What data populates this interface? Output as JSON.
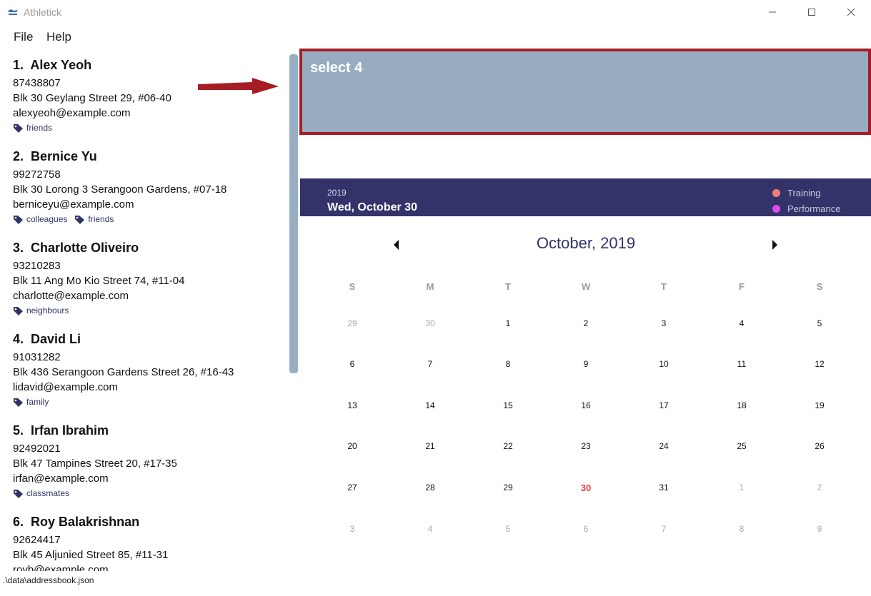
{
  "window": {
    "title": "Athletick",
    "controls": {
      "minimize_icon": "minimize-icon",
      "maximize_icon": "maximize-icon",
      "close_icon": "close-icon"
    }
  },
  "menu": {
    "file": "File",
    "help": "Help"
  },
  "persons": [
    {
      "index": "1.",
      "name": "Alex Yeoh",
      "phone": "87438807",
      "address": "Blk 30 Geylang Street 29, #06-40",
      "email": "alexyeoh@example.com",
      "tags": [
        "friends"
      ]
    },
    {
      "index": "2.",
      "name": "Bernice Yu",
      "phone": "99272758",
      "address": "Blk 30 Lorong 3 Serangoon Gardens, #07-18",
      "email": "berniceyu@example.com",
      "tags": [
        "colleagues",
        "friends"
      ]
    },
    {
      "index": "3.",
      "name": "Charlotte Oliveiro",
      "phone": "93210283",
      "address": "Blk 11 Ang Mo Kio Street 74, #11-04",
      "email": "charlotte@example.com",
      "tags": [
        "neighbours"
      ]
    },
    {
      "index": "4.",
      "name": "David Li",
      "phone": "91031282",
      "address": "Blk 436 Serangoon Gardens Street 26, #16-43",
      "email": "lidavid@example.com",
      "tags": [
        "family"
      ]
    },
    {
      "index": "5.",
      "name": "Irfan Ibrahim",
      "phone": "92492021",
      "address": "Blk 47 Tampines Street 20, #17-35",
      "email": "irfan@example.com",
      "tags": [
        "classmates"
      ]
    },
    {
      "index": "6.",
      "name": "Roy Balakrishnan",
      "phone": "92624417",
      "address": "Blk 45 Aljunied Street 85, #11-31",
      "email": "royb@example.com",
      "tags": []
    }
  ],
  "command": {
    "text": "select 4"
  },
  "calendar": {
    "year": "2019",
    "selected_date": "Wed, October 30",
    "legend": [
      {
        "label": "Training",
        "color": "#f07f7a"
      },
      {
        "label": "Performance",
        "color": "#de4bf2"
      }
    ],
    "month_title": "October, 2019",
    "days_of_week": [
      "S",
      "M",
      "T",
      "W",
      "T",
      "F",
      "S"
    ],
    "weeks": [
      [
        {
          "d": "29",
          "o": true
        },
        {
          "d": "30",
          "o": true
        },
        {
          "d": "1"
        },
        {
          "d": "2"
        },
        {
          "d": "3"
        },
        {
          "d": "4"
        },
        {
          "d": "5"
        }
      ],
      [
        {
          "d": "6"
        },
        {
          "d": "7"
        },
        {
          "d": "8"
        },
        {
          "d": "9"
        },
        {
          "d": "10"
        },
        {
          "d": "11"
        },
        {
          "d": "12"
        }
      ],
      [
        {
          "d": "13"
        },
        {
          "d": "14"
        },
        {
          "d": "15"
        },
        {
          "d": "16"
        },
        {
          "d": "17"
        },
        {
          "d": "18"
        },
        {
          "d": "19"
        }
      ],
      [
        {
          "d": "20"
        },
        {
          "d": "21"
        },
        {
          "d": "22"
        },
        {
          "d": "23"
        },
        {
          "d": "24"
        },
        {
          "d": "25"
        },
        {
          "d": "26"
        }
      ],
      [
        {
          "d": "27"
        },
        {
          "d": "28"
        },
        {
          "d": "29"
        },
        {
          "d": "30",
          "t": true
        },
        {
          "d": "31"
        },
        {
          "d": "1",
          "o": true
        },
        {
          "d": "2",
          "o": true
        }
      ],
      [
        {
          "d": "3",
          "o": true
        },
        {
          "d": "4",
          "o": true
        },
        {
          "d": "5",
          "o": true
        },
        {
          "d": "6",
          "o": true
        },
        {
          "d": "7",
          "o": true
        },
        {
          "d": "8",
          "o": true
        },
        {
          "d": "9",
          "o": true
        }
      ]
    ]
  },
  "status": {
    "file_path": ".\\data\\addressbook.json"
  },
  "colors": {
    "accent": "#33336a",
    "command_bg": "#97acc0",
    "highlight_border": "#a61c24",
    "today": "#e53935"
  }
}
